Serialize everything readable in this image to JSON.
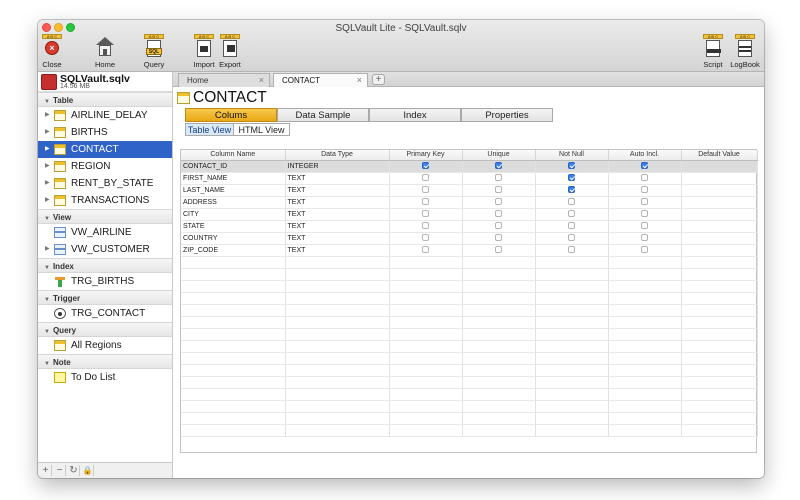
{
  "window": {
    "title": "SQLVault Lite - SQLVault.sqlv"
  },
  "toolbar": {
    "items": [
      {
        "label": "Close",
        "icon": "close-icon"
      },
      {
        "label": "Home",
        "icon": "home-icon"
      },
      {
        "label": "Query",
        "icon": "query-icon",
        "badge": "SQL"
      },
      {
        "label": "Import",
        "icon": "import-icon"
      },
      {
        "label": "Export",
        "icon": "export-icon"
      },
      {
        "label": "Script",
        "icon": "script-icon"
      },
      {
        "label": "LogBook",
        "icon": "logbook-icon"
      }
    ],
    "icon_badge": "A B C"
  },
  "sidebar": {
    "db_name": "SQLVault.sqlv",
    "db_size": "14.56 MB",
    "sections": {
      "table": "Table",
      "view": "View",
      "index": "Index",
      "trigger": "Trigger",
      "query": "Query",
      "note": "Note"
    },
    "tables": [
      "AIRLINE_DELAY",
      "BIRTHS",
      "CONTACT",
      "REGION",
      "RENT_BY_STATE",
      "TRANSACTIONS"
    ],
    "views": [
      "VW_AIRLINE",
      "VW_CUSTOMER"
    ],
    "indexes": [
      "TRG_BIRTHS"
    ],
    "triggers": [
      "TRG_CONTACT"
    ],
    "queries": [
      "All Regions"
    ],
    "notes": [
      "To Do List"
    ],
    "footer": {
      "add": "+",
      "remove": "−",
      "refresh": "↻",
      "lock": "🔒"
    }
  },
  "tabs": [
    {
      "label": "Home"
    },
    {
      "label": "CONTACT"
    }
  ],
  "tab_add": "+",
  "object": {
    "title": "CONTACT",
    "subtabs": [
      "Colums",
      "Data Sample",
      "Index",
      "Properties"
    ],
    "view_tabs": [
      "Table View",
      "HTML View"
    ]
  },
  "grid": {
    "headers": [
      "Column Name",
      "Data Type",
      "Primary Key",
      "Unique",
      "Not Null",
      "Auto Incl.",
      "Default Value"
    ],
    "rows": [
      {
        "name": "CONTACT_ID",
        "type": "INTEGER",
        "pk": true,
        "unique": true,
        "notnull": true,
        "auto": true,
        "default": ""
      },
      {
        "name": "FIRST_NAME",
        "type": "TEXT",
        "pk": false,
        "unique": false,
        "notnull": true,
        "auto": false,
        "default": ""
      },
      {
        "name": "LAST_NAME",
        "type": "TEXT",
        "pk": false,
        "unique": false,
        "notnull": true,
        "auto": false,
        "default": ""
      },
      {
        "name": "ADDRESS",
        "type": "TEXT",
        "pk": false,
        "unique": false,
        "notnull": false,
        "auto": false,
        "default": ""
      },
      {
        "name": "CITY",
        "type": "TEXT",
        "pk": false,
        "unique": false,
        "notnull": false,
        "auto": false,
        "default": ""
      },
      {
        "name": "STATE",
        "type": "TEXT",
        "pk": false,
        "unique": false,
        "notnull": false,
        "auto": false,
        "default": ""
      },
      {
        "name": "COUNTRY",
        "type": "TEXT",
        "pk": false,
        "unique": false,
        "notnull": false,
        "auto": false,
        "default": ""
      },
      {
        "name": "ZIP_CODE",
        "type": "TEXT",
        "pk": false,
        "unique": false,
        "notnull": false,
        "auto": false,
        "default": ""
      }
    ]
  },
  "colors": {
    "accent": "#2f63c8",
    "tab_active": "#f0b82e",
    "checkbox_on": "#3b82e8"
  }
}
